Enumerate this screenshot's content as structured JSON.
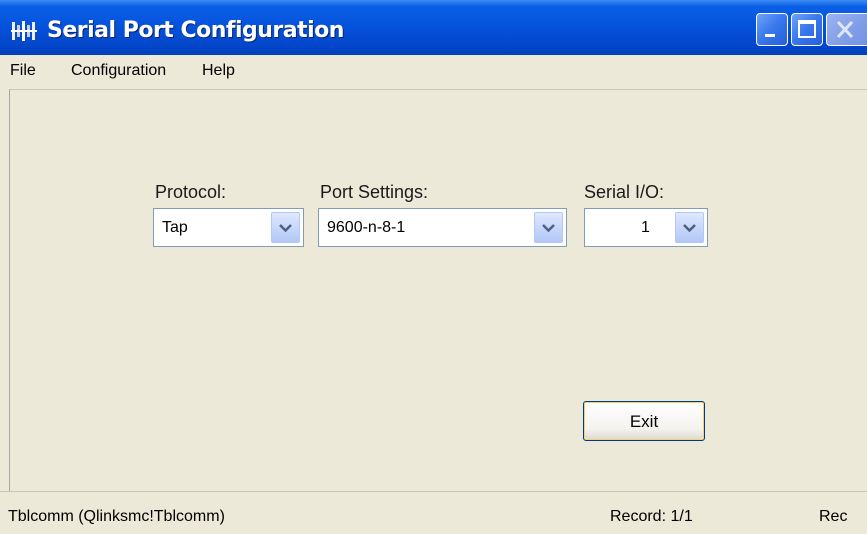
{
  "window": {
    "title": "Serial Port Configuration"
  },
  "menu": {
    "items": [
      "File",
      "Configuration",
      "Help"
    ]
  },
  "form": {
    "protocol": {
      "label": "Protocol:",
      "value": "Tap"
    },
    "port_settings": {
      "label": "Port Settings:",
      "value": "9600-n-8-1"
    },
    "serial_io": {
      "label": "Serial I/O:",
      "value": "1"
    }
  },
  "buttons": {
    "exit_label": "Exit"
  },
  "status": {
    "left": "Tblcomm (Qlinksmc!Tblcomm)",
    "record": "Record: 1/1",
    "right": "Rec"
  },
  "colors": {
    "title_bar": "#0551db",
    "window_bg": "#ece9d8",
    "combo_border": "#7f9db9"
  }
}
